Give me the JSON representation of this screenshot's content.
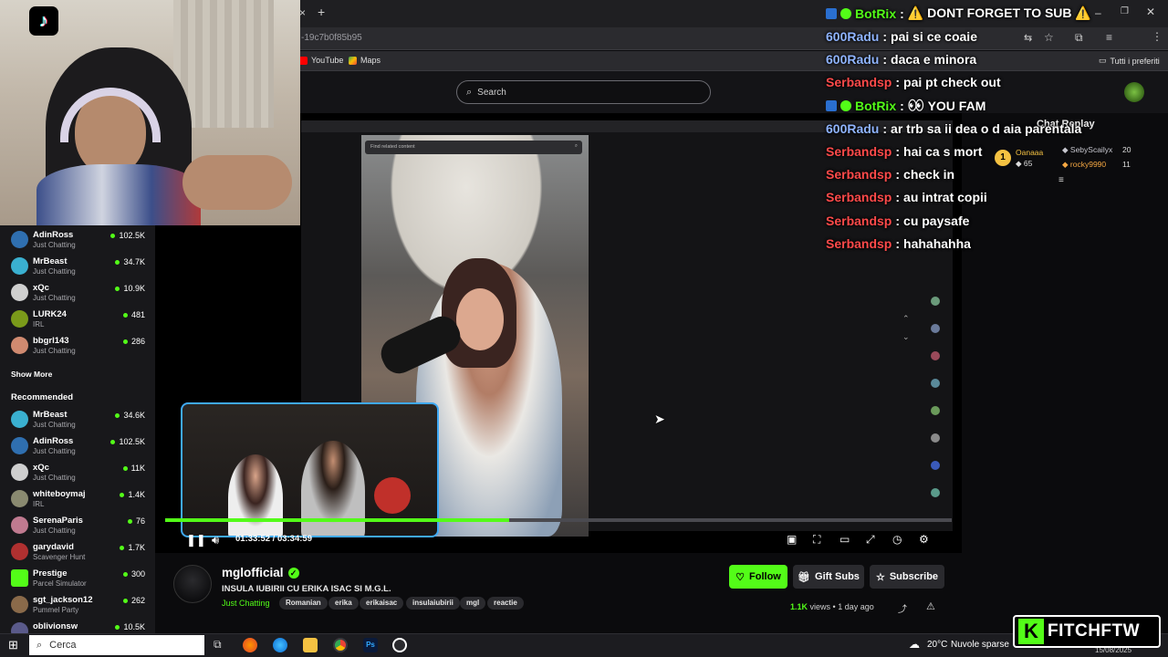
{
  "browser": {
    "address_fragment": "-19c7b0f85b95",
    "bookmarks": [
      "YouTube",
      "Maps"
    ],
    "all_bookmarks": "Tutti i preferiti"
  },
  "site": {
    "search_placeholder": "Search",
    "chat_replay_label": "Chat Replay"
  },
  "sidebar": {
    "following": [
      {
        "name": "AdinRoss",
        "category": "Just Chatting",
        "viewers": "102.5K",
        "color": "#2f6fb0"
      },
      {
        "name": "MrBeast",
        "category": "Just Chatting",
        "viewers": "34.7K",
        "color": "#3ab0d0"
      },
      {
        "name": "xQc",
        "category": "Just Chatting",
        "viewers": "10.9K",
        "color": "#cfcfcf"
      },
      {
        "name": "LURK24",
        "category": "IRL",
        "viewers": "481",
        "color": "#7a9a1a"
      },
      {
        "name": "bbgrl143",
        "category": "Just Chatting",
        "viewers": "286",
        "color": "#d08a70"
      }
    ],
    "show_more": "Show More",
    "recommended_title": "Recommended",
    "recommended": [
      {
        "name": "MrBeast",
        "category": "Just Chatting",
        "viewers": "34.6K",
        "color": "#3ab0d0"
      },
      {
        "name": "AdinRoss",
        "category": "Just Chatting",
        "viewers": "102.5K",
        "color": "#2f6fb0"
      },
      {
        "name": "xQc",
        "category": "Just Chatting",
        "viewers": "11K",
        "color": "#cfcfcf"
      },
      {
        "name": "whiteboymaj",
        "category": "IRL",
        "viewers": "1.4K",
        "color": "#8a8a70"
      },
      {
        "name": "SerenaParis",
        "category": "Just Chatting",
        "viewers": "76",
        "color": "#c07a90"
      },
      {
        "name": "garydavid",
        "category": "Scavenger Hunt",
        "viewers": "1.7K",
        "color": "#b03030"
      },
      {
        "name": "Prestige",
        "category": "Parcel Simulator",
        "viewers": "300",
        "color": "#53fc18"
      },
      {
        "name": "sgt_jackson12",
        "category": "Pummel Party",
        "viewers": "262",
        "color": "#8a6a4a"
      },
      {
        "name": "oblivionsw",
        "category": "",
        "viewers": "10.5K",
        "color": "#5a5a8a"
      }
    ]
  },
  "player": {
    "current_time": "01:33:52",
    "duration": "03:34:59",
    "progress_fraction": 0.437,
    "find_placeholder": "Find related content"
  },
  "stream": {
    "streamer": "mglofficial",
    "title": "INSULA IUBIRII CU ERIKA ISAC SI M.G.L.",
    "category": "Just Chatting",
    "tags": [
      "Romanian",
      "erika",
      "erikaisac",
      "insulaiubirii",
      "mgl",
      "reactie"
    ],
    "views": "1.1K",
    "views_label": "views",
    "age": "1 day ago",
    "follow": "Follow",
    "gift": "Gift Subs",
    "subscribe": "Subscribe"
  },
  "leaderboard": [
    {
      "name": "Oanaaa",
      "count": "65",
      "color": "#f5c242"
    },
    {
      "name": "SebyScailyx",
      "count": "20",
      "color": "#c7c7cf"
    },
    {
      "name": "rocky9990",
      "count": "11",
      "color": "#f5a742"
    }
  ],
  "chat_overlay": [
    {
      "user": "BotRix",
      "text": "⚠️ DONT FORGET TO SUB ⚠️",
      "color": "#53fc18"
    },
    {
      "user": "600Radu",
      "text": "pai si ce coaie",
      "color": "#8fb4ff"
    },
    {
      "user": "600Radu",
      "text": "daca e minora",
      "color": "#8fb4ff"
    },
    {
      "user": "Serbandsp",
      "text": "pai pt check out",
      "color": "#ff4a4a"
    },
    {
      "user": "BotRix",
      "text": "YOU FAM",
      "color": "#53fc18"
    },
    {
      "user": "600Radu",
      "text": "ar trb sa ii dea o d aia parentala",
      "color": "#8fb4ff"
    },
    {
      "user": "Serbandsp",
      "text": "hai ca s mort",
      "color": "#ff4a4a"
    },
    {
      "user": "Serbandsp",
      "text": "check in",
      "color": "#ff4a4a"
    },
    {
      "user": "Serbandsp",
      "text": "au intrat copii",
      "color": "#ff4a4a"
    },
    {
      "user": "Serbandsp",
      "text": "cu paysafe",
      "color": "#ff4a4a"
    },
    {
      "user": "Serbandsp",
      "text": "hahahahha",
      "color": "#ff4a4a"
    }
  ],
  "taskbar": {
    "search": "Cerca",
    "temp": "20°C",
    "weather": "Nuvole sparse",
    "date": "15/08/2025"
  },
  "watermark": {
    "k": "K",
    "text": "FITCHFTW"
  },
  "colors": {
    "accent": "#53fc18",
    "pip_border": "#3fa9f5"
  }
}
